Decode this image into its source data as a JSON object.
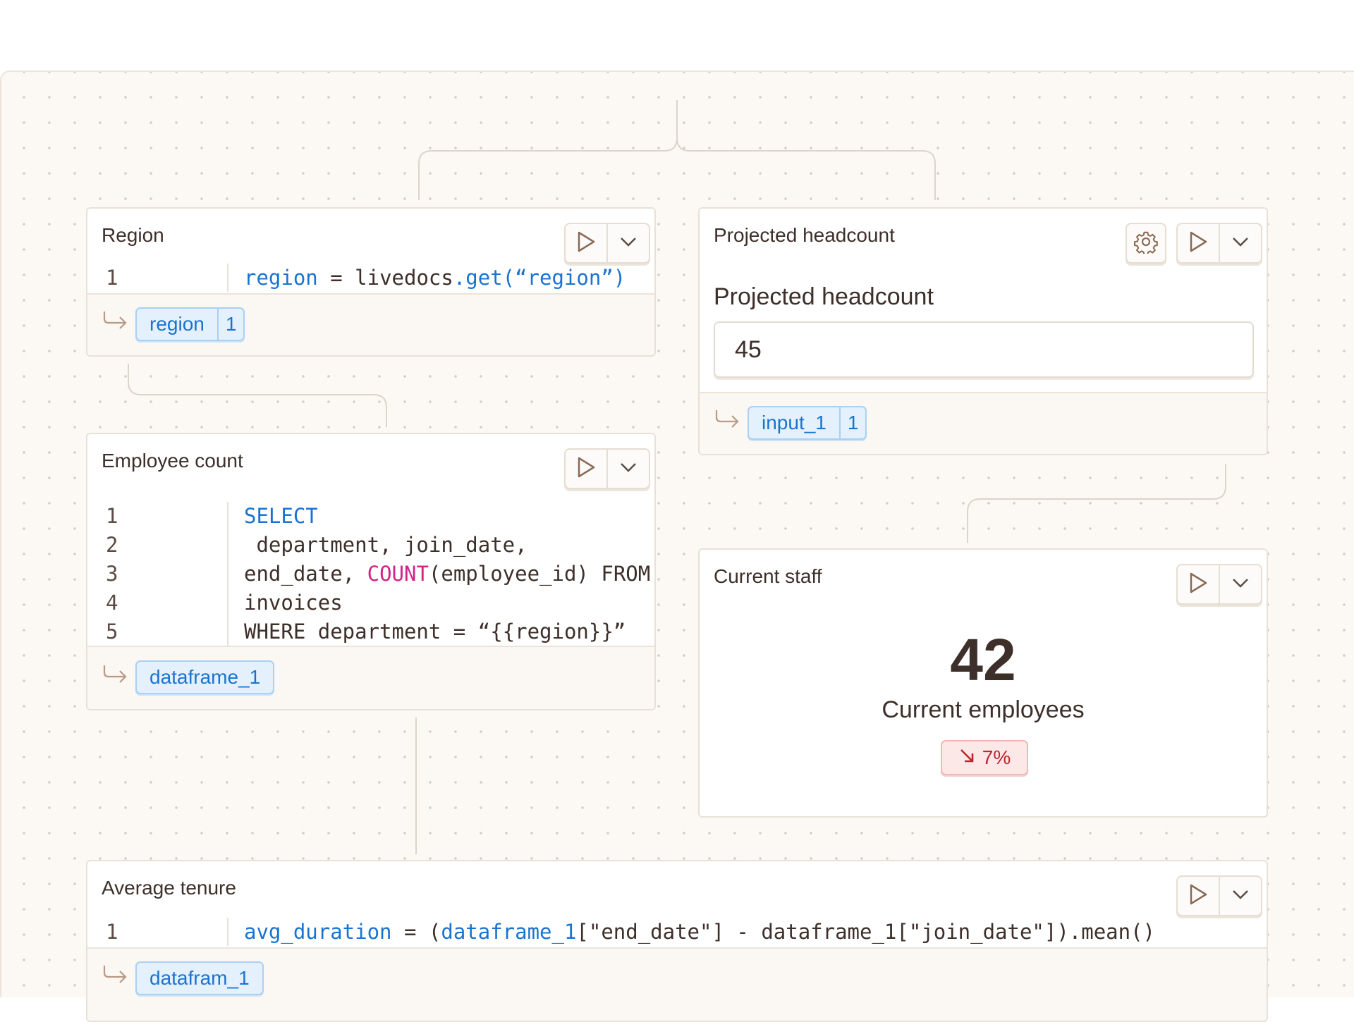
{
  "colors": {
    "canvas_bg": "#fcf9f5",
    "keyword_blue": "#1a73d1",
    "function_pink": "#d1248a",
    "negative_red": "#c0242c"
  },
  "icons": [
    "run-icon",
    "chevron-down-icon",
    "gear-icon",
    "output-arrow-icon",
    "trend-down-icon"
  ],
  "cells": {
    "region": {
      "title": "Region",
      "code": [
        {
          "num": "1",
          "parts": [
            {
              "t": "region",
              "c": "kw"
            },
            {
              "t": " = livedocs",
              "c": ""
            },
            {
              "t": ".get(“region”)",
              "c": "kw"
            }
          ]
        }
      ],
      "output": {
        "name": "region",
        "count": "1"
      }
    },
    "employee_count": {
      "title": "Employee count",
      "code": [
        {
          "num": "1",
          "parts": [
            {
              "t": "SELECT",
              "c": "kw"
            }
          ]
        },
        {
          "num": "2",
          "parts": [
            {
              "t": " department, join_date,",
              "c": ""
            }
          ]
        },
        {
          "num": "3",
          "parts": [
            {
              "t": "end_date, ",
              "c": ""
            },
            {
              "t": "COUNT",
              "c": "fn"
            },
            {
              "t": "(employee_id) FROM",
              "c": ""
            }
          ]
        },
        {
          "num": "4",
          "parts": [
            {
              "t": "invoices",
              "c": ""
            }
          ]
        },
        {
          "num": "5",
          "parts": [
            {
              "t": "WHERE department = “{{region}}”",
              "c": ""
            }
          ]
        }
      ],
      "output": {
        "name": "dataframe_1"
      }
    },
    "projected_headcount": {
      "title": "Projected headcount",
      "label": "Projected headcount",
      "input_value": "45",
      "output": {
        "name": "input_1",
        "count": "1"
      }
    },
    "current_staff": {
      "title": "Current staff",
      "value": "42",
      "label": "Current employees",
      "delta": "7%"
    },
    "average_tenure": {
      "title": "Average tenure",
      "code": [
        {
          "num": "1",
          "parts": [
            {
              "t": "avg_duration",
              "c": "kw"
            },
            {
              "t": " = (",
              "c": ""
            },
            {
              "t": "dataframe_1",
              "c": "kw"
            },
            {
              "t": "[\"end_date\"] - dataframe_1[\"join_date\"]).mean()",
              "c": ""
            }
          ]
        }
      ],
      "output": {
        "name": "datafram_1"
      }
    }
  }
}
